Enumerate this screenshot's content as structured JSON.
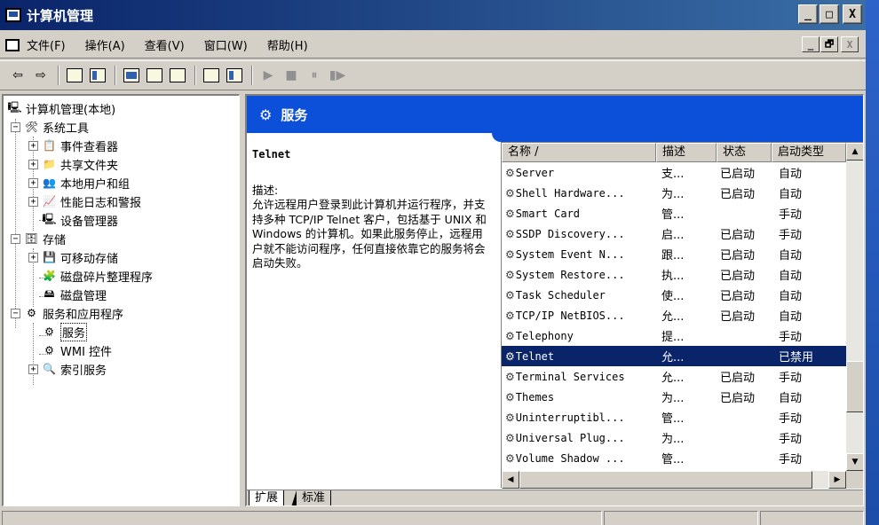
{
  "window": {
    "title": "计算机管理",
    "controls": {
      "minimize": "_",
      "maximize": "□",
      "close": "X"
    }
  },
  "menu": {
    "items": [
      "文件(F)",
      "操作(A)",
      "查看(V)",
      "窗口(W)",
      "帮助(H)"
    ],
    "mdi_controls": {
      "minimize": "_",
      "restore": "🗗",
      "close": "X"
    }
  },
  "toolbar": {
    "back": "⇦",
    "forward": "⇨",
    "play": "▶",
    "stop": "■",
    "pause": "⏸",
    "resume": "▮▶"
  },
  "tree": {
    "root": "计算机管理(本地)",
    "nodes": [
      {
        "label": "系统工具",
        "icon": "tools-icon"
      },
      {
        "label": "事件查看器",
        "icon": "event-viewer-icon"
      },
      {
        "label": "共享文件夹",
        "icon": "shared-folder-icon"
      },
      {
        "label": "本地用户和组",
        "icon": "users-icon"
      },
      {
        "label": "性能日志和警报",
        "icon": "performance-icon"
      },
      {
        "label": "设备管理器",
        "icon": "device-manager-icon"
      },
      {
        "label": "存储",
        "icon": "storage-icon"
      },
      {
        "label": "可移动存储",
        "icon": "removable-storage-icon"
      },
      {
        "label": "磁盘碎片整理程序",
        "icon": "defrag-icon"
      },
      {
        "label": "磁盘管理",
        "icon": "disk-management-icon"
      },
      {
        "label": "服务和应用程序",
        "icon": "services-apps-icon"
      },
      {
        "label": "服务",
        "icon": "services-icon"
      },
      {
        "label": "WMI 控件",
        "icon": "wmi-icon"
      },
      {
        "label": "索引服务",
        "icon": "indexing-icon"
      }
    ]
  },
  "panel": {
    "header": "服务",
    "selected_service": "Telnet",
    "desc_label": "描述:",
    "desc_text": "允许远程用户登录到此计算机并运行程序，并支持多种 TCP/IP Telnet 客户，包括基于 UNIX 和 Windows 的计算机。如果此服务停止，远程用户就不能访问程序，任何直接依靠它的服务将会启动失败。"
  },
  "list": {
    "columns": [
      "名称 /",
      "描述",
      "状态",
      "启动类型"
    ],
    "rows": [
      {
        "name": "Server",
        "desc": "支...",
        "status": "已启动",
        "start": "自动"
      },
      {
        "name": "Shell Hardware...",
        "desc": "为...",
        "status": "已启动",
        "start": "自动"
      },
      {
        "name": "Smart Card",
        "desc": "管...",
        "status": "",
        "start": "手动"
      },
      {
        "name": "SSDP Discovery...",
        "desc": "启...",
        "status": "已启动",
        "start": "手动"
      },
      {
        "name": "System Event N...",
        "desc": "跟...",
        "status": "已启动",
        "start": "自动"
      },
      {
        "name": "System Restore...",
        "desc": "执...",
        "status": "已启动",
        "start": "自动"
      },
      {
        "name": "Task Scheduler",
        "desc": "使...",
        "status": "已启动",
        "start": "自动"
      },
      {
        "name": "TCP/IP NetBIOS...",
        "desc": "允...",
        "status": "已启动",
        "start": "自动"
      },
      {
        "name": "Telephony",
        "desc": "提...",
        "status": "",
        "start": "手动"
      },
      {
        "name": "Telnet",
        "desc": "允...",
        "status": "",
        "start": "已禁用"
      },
      {
        "name": "Terminal Services",
        "desc": "允...",
        "status": "已启动",
        "start": "手动"
      },
      {
        "name": "Themes",
        "desc": "为...",
        "status": "已启动",
        "start": "自动"
      },
      {
        "name": "Uninterruptibl...",
        "desc": "管...",
        "status": "",
        "start": "手动"
      },
      {
        "name": "Universal Plug...",
        "desc": "为...",
        "status": "",
        "start": "手动"
      },
      {
        "name": "Volume Shadow ...",
        "desc": "管...",
        "status": "",
        "start": "手动"
      }
    ],
    "selected_index": 9
  },
  "tabs": {
    "extended": "扩展",
    "standard": "标准"
  },
  "colors": {
    "header_blue": "#0c4fd8",
    "selection": "#0a246a",
    "chrome": "#d4d0c8"
  }
}
